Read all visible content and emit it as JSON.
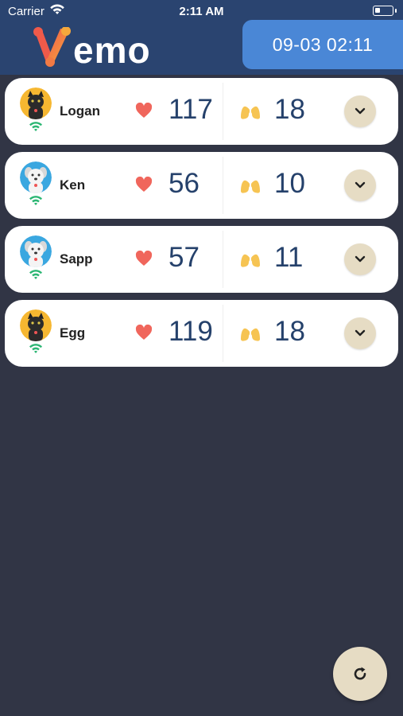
{
  "status_bar": {
    "carrier": "Carrier",
    "time": "2:11 AM",
    "icons": [
      "wifi-icon",
      "battery-icon"
    ]
  },
  "header": {
    "logo_text": "emo",
    "logo_letter": "V",
    "datetime": "09-03 02:11",
    "colors": {
      "bar": "#2a4470",
      "datebox": "#4a87d6"
    }
  },
  "pets": [
    {
      "name": "Logan",
      "avatar": "black-cat-avatar",
      "heart_rate": "117",
      "resp_rate": "18"
    },
    {
      "name": "Ken",
      "avatar": "white-dog-avatar",
      "heart_rate": "56",
      "resp_rate": "10"
    },
    {
      "name": "Sapp",
      "avatar": "white-dog-avatar",
      "heart_rate": "57",
      "resp_rate": "11"
    },
    {
      "name": "Egg",
      "avatar": "black-cat-avatar",
      "heart_rate": "119",
      "resp_rate": "18"
    }
  ],
  "icons": {
    "heart": "heart-icon",
    "lungs": "lungs-icon",
    "expand": "chevron-down-icon",
    "refresh": "refresh-icon",
    "connection": "wifi-icon"
  },
  "colors": {
    "background": "#313545",
    "heart": "#f0665c",
    "lungs": "#f6c453",
    "value": "#25416b",
    "wifi": "#2bb673",
    "button": "#e6dcc4"
  }
}
